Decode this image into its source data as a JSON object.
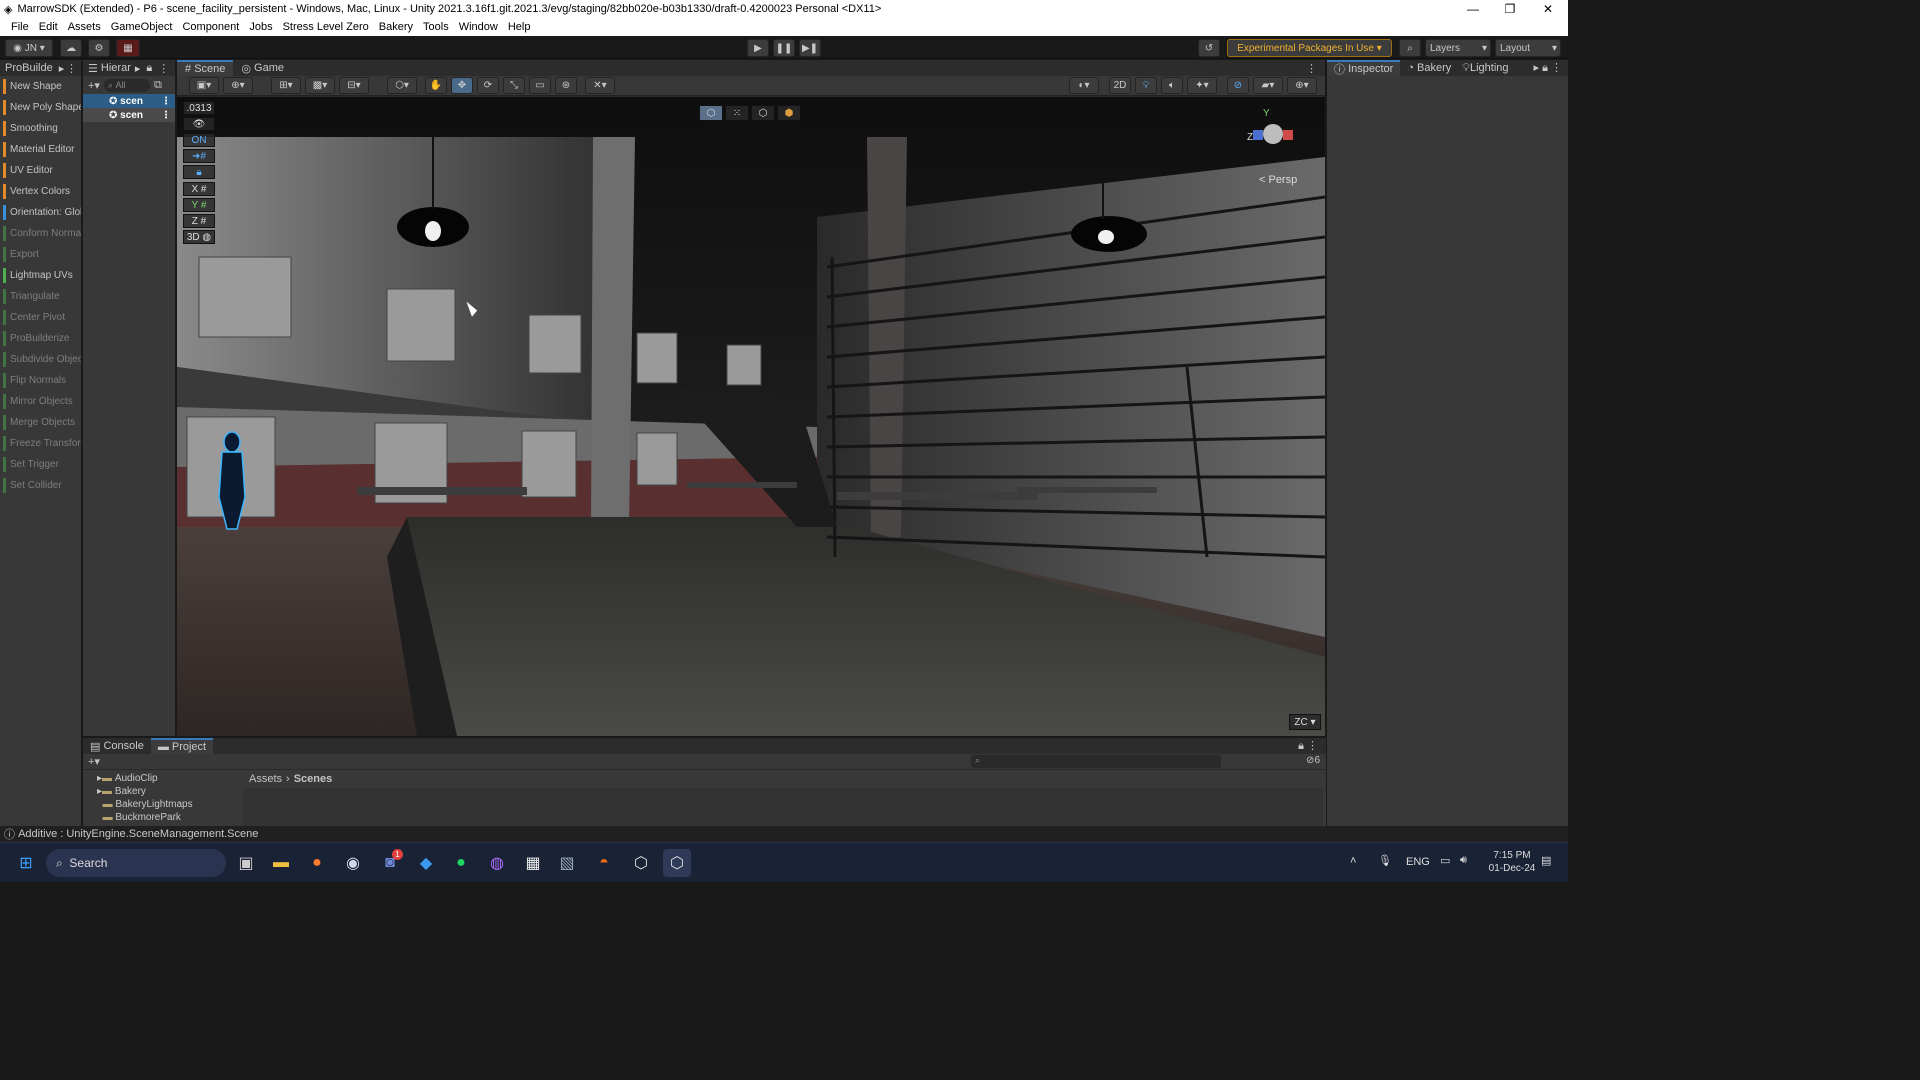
{
  "window": {
    "title": "MarrowSDK (Extended) - P6 - scene_facility_persistent - Windows, Mac, Linux - Unity 2021.3.16f1.git.2021.3/evg/staging/82bb020e-b03b1330/draft-0.4200023 Personal <DX11>"
  },
  "menu": [
    "File",
    "Edit",
    "Assets",
    "GameObject",
    "Component",
    "Jobs",
    "Stress Level Zero",
    "Bakery",
    "Tools",
    "Window",
    "Help"
  ],
  "toolbar": {
    "account": "JN",
    "experimental": "Experimental Packages In Use ▾",
    "layers": "Layers",
    "layout": "Layout"
  },
  "probuilder": {
    "title": "ProBuilde",
    "items": [
      {
        "label": "New Shape",
        "color": "#e08a2a",
        "enabled": true
      },
      {
        "label": "New Poly Shape",
        "color": "#e08a2a",
        "enabled": true
      },
      {
        "label": "Smoothing",
        "color": "#e08a2a",
        "enabled": true
      },
      {
        "label": "Material Editor",
        "color": "#e08a2a",
        "enabled": true
      },
      {
        "label": "UV Editor",
        "color": "#e08a2a",
        "enabled": true
      },
      {
        "label": "Vertex Colors",
        "color": "#e08a2a",
        "enabled": true
      },
      {
        "label": "Orientation: Glob",
        "color": "#3a8fd8",
        "enabled": true
      },
      {
        "label": "Conform Normal",
        "color": "#4caf50",
        "enabled": false
      },
      {
        "label": "Export",
        "color": "#4caf50",
        "enabled": false
      },
      {
        "label": "Lightmap UVs",
        "color": "#4caf50",
        "enabled": true
      },
      {
        "label": "Triangulate",
        "color": "#4caf50",
        "enabled": false
      },
      {
        "label": "Center Pivot",
        "color": "#4caf50",
        "enabled": false
      },
      {
        "label": "ProBuilderize",
        "color": "#4caf50",
        "enabled": false
      },
      {
        "label": "Subdivide Object",
        "color": "#4caf50",
        "enabled": false
      },
      {
        "label": "Flip Normals",
        "color": "#4caf50",
        "enabled": false
      },
      {
        "label": "Mirror Objects",
        "color": "#4caf50",
        "enabled": false
      },
      {
        "label": "Merge Objects",
        "color": "#4caf50",
        "enabled": false
      },
      {
        "label": "Freeze Transform",
        "color": "#4caf50",
        "enabled": false
      },
      {
        "label": "Set Trigger",
        "color": "#4caf50",
        "enabled": false
      },
      {
        "label": "Set Collider",
        "color": "#4caf50",
        "enabled": false
      }
    ]
  },
  "hierarchy": {
    "tab": "Hierar",
    "search": "All",
    "rows": [
      "scen",
      "scen"
    ]
  },
  "scene": {
    "tabs": [
      "Scene",
      "Game"
    ],
    "grid_value": ".0313",
    "on_label": "ON",
    "axes": [
      "X",
      "Y",
      "Z",
      "3D"
    ],
    "persp": "< Persp",
    "zoom": "ZC",
    "mode_2d": "2D"
  },
  "inspector": {
    "tabs": [
      "Inspector",
      "Bakery",
      "Lighting"
    ]
  },
  "bottom": {
    "tabs": [
      "Console",
      "Project"
    ],
    "tree": [
      "AudioClip",
      "Bakery",
      "BakeryLightmaps",
      "BuckmorePark"
    ],
    "breadcrumb": [
      "Assets",
      "Scenes"
    ],
    "hidden_count": "6"
  },
  "status": {
    "text": "Additive : UnityEngine.SceneManagement.Scene"
  },
  "taskbar": {
    "search": "Search",
    "lang": "ENG",
    "time": "7:15 PM",
    "date": "01-Dec-24",
    "discord_badge": "1"
  }
}
